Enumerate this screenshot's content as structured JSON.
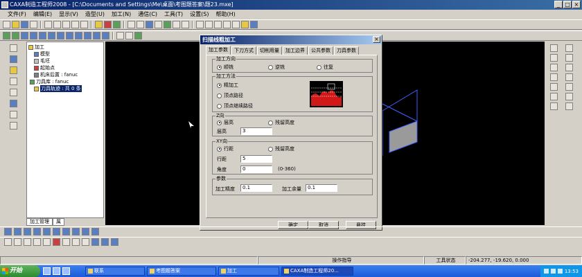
{
  "window": {
    "title": "CAXA制造工程师2008 - [C:\\Documents and Settings\\Me\\桌面\\考图题答案\\题23.mxe]",
    "min_label": "_",
    "max_label": "□",
    "close_label": "×"
  },
  "menu": [
    "文件(F)",
    "编辑(E)",
    "显示(V)",
    "造型(U)",
    "加工(N)",
    "通信(C)",
    "工具(T)",
    "设置(S)",
    "帮助(H)"
  ],
  "tree": {
    "nodes": [
      "加工",
      "模型",
      "毛坯",
      "起始点",
      "机床后置 : fanuc",
      "刀具库 : fanuc",
      "刀具轨迹 : 共 0 条"
    ],
    "tabs": [
      "加工管理",
      "属"
    ]
  },
  "dialog": {
    "title": "扫描线粗加工",
    "close_label": "×",
    "tabs": [
      "加工参数",
      "下刀方式",
      "切削用量",
      "加工边界",
      "公共参数",
      "刀具参数"
    ],
    "direction": {
      "title": "加工方向",
      "options": [
        "顺铣",
        "逆铣",
        "往复"
      ]
    },
    "method": {
      "title": "加工方法",
      "options": [
        "精加工",
        "顶点路径",
        "顶点继续路径"
      ]
    },
    "z": {
      "title": "Z向",
      "options": [
        "层高",
        "残留高度"
      ],
      "layer_label": "层高",
      "layer_value": "3"
    },
    "xy": {
      "title": "XY向",
      "options": [
        "行距",
        "残留高度"
      ],
      "step_label": "行距",
      "step_value": "5",
      "angle_label": "角度",
      "angle_value": "0",
      "angle_range": "(0-360)"
    },
    "params": {
      "title": "参数",
      "precision_label": "加工精度",
      "precision_value": "0.1",
      "allowance_label": "加工余量",
      "allowance_value": "0.1"
    },
    "buttons": {
      "ok": "确定",
      "cancel": "取消",
      "hang": "悬挂"
    }
  },
  "status": {
    "prompt": "操作指导",
    "tool_state": "工具状态",
    "coords": "-204.277, -19.620, 0.000"
  },
  "taskbar": {
    "start": "开始",
    "tasks": [
      "联系",
      "考图题答案",
      "加工",
      "CAXA制造工程师20..."
    ],
    "clock": "13:53"
  }
}
